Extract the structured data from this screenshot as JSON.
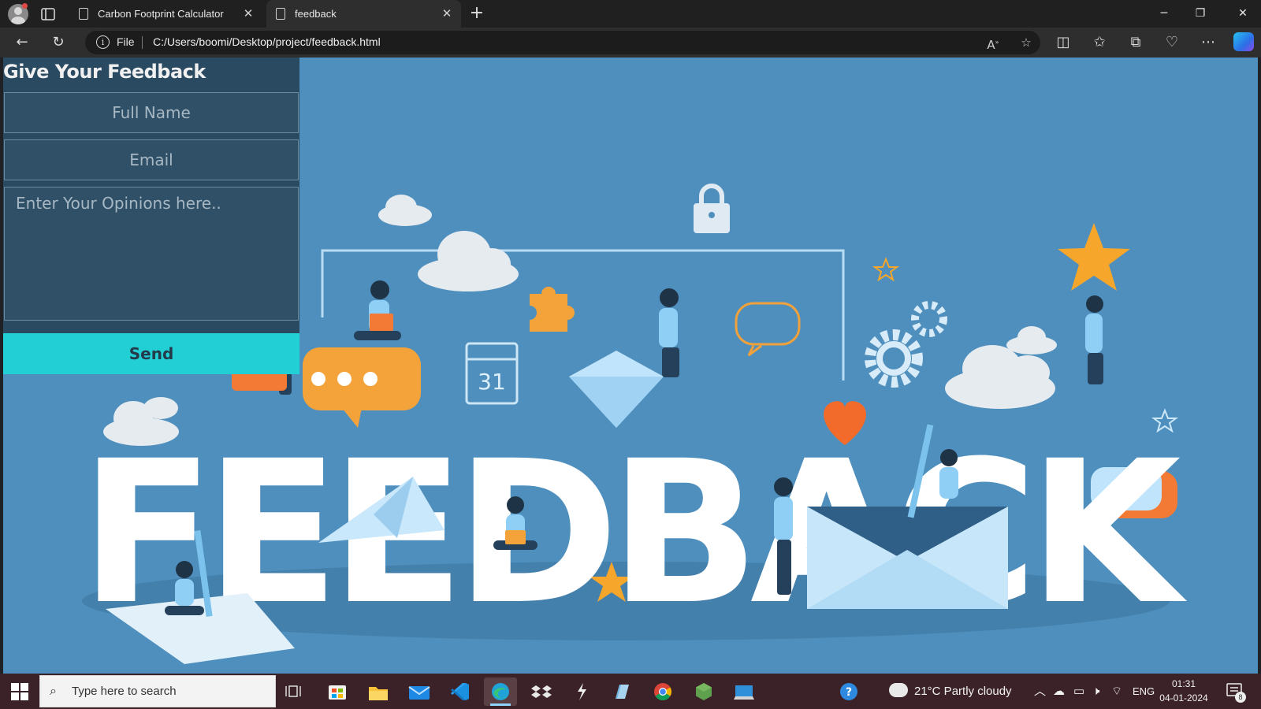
{
  "browser": {
    "tabs": [
      {
        "title": "Carbon Footprint Calculator",
        "active": false
      },
      {
        "title": "feedback",
        "active": true
      }
    ],
    "address": {
      "scheme_label": "File",
      "url": "C:/Users/boomi/Desktop/project/feedback.html"
    }
  },
  "page": {
    "title": "Give Your Feedback",
    "name_placeholder": "Full Name",
    "email_placeholder": "Email",
    "message_placeholder": "Enter Your Opinions here..",
    "send_label": "Send",
    "background_color": "#4f8fbd",
    "accent_color": "#22cfd4",
    "illustration": {
      "headline": "FEEDBACK",
      "calendar_day": "31"
    }
  },
  "taskbar": {
    "search_placeholder": "Type here to search",
    "weather": "21°C  Partly cloudy",
    "language": "ENG",
    "time": "01:31",
    "date": "04-01-2024",
    "notifications": "8",
    "apps": [
      "task-view",
      "microsoft-store",
      "file-explorer",
      "mail",
      "vs-code",
      "edge",
      "dropbox",
      "app-bolt",
      "app-notes",
      "chrome",
      "nodejs",
      "remote-desktop"
    ]
  }
}
